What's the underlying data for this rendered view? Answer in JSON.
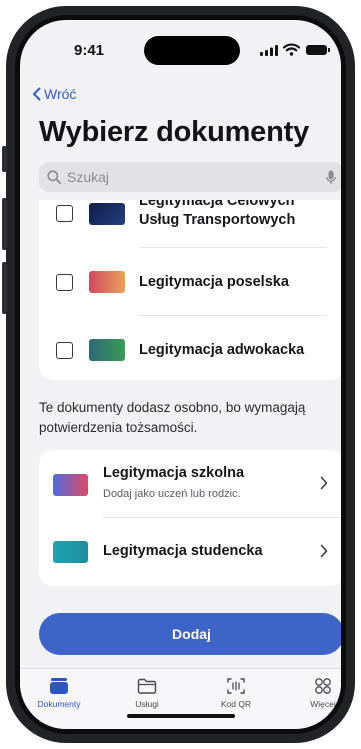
{
  "status_bar": {
    "time": "9:41"
  },
  "nav": {
    "back_label": "Wróć"
  },
  "header": {
    "title": "Wybierz dokumenty"
  },
  "search": {
    "placeholder": "Szukaj"
  },
  "documents": [
    {
      "label_line1": "Legitymacja Celowych",
      "label_line2": "Usług Transportowych",
      "checked": false,
      "card_color": "#20306a"
    },
    {
      "label": "Legitymacja poselska",
      "checked": false,
      "card_color": "#d9545e"
    },
    {
      "label": "Legitymacja adwokacka",
      "checked": false,
      "card_color": "#2f8c5e"
    }
  ],
  "note": {
    "text": "Te dokumenty dodasz osobno, bo wymagają potwierdzenia tożsamości."
  },
  "separate_documents": [
    {
      "label": "Legitymacja szkolna",
      "sublabel": "Dodaj jako uczeń lub rodzic.",
      "card_color": "#4466dd"
    },
    {
      "label": "Legitymacja studencka",
      "card_color": "#23a3ae"
    }
  ],
  "primary_action": {
    "label": "Dodaj",
    "color": "#3d64c8"
  },
  "tab_bar": {
    "tabs": [
      {
        "label": "Dokumenty",
        "icon": "wallet-icon",
        "active": true
      },
      {
        "label": "Usługi",
        "icon": "folder-icon",
        "active": false
      },
      {
        "label": "Kod QR",
        "icon": "qr-scan-icon",
        "active": false
      },
      {
        "label": "Więcej",
        "icon": "grid-more-icon",
        "active": false
      }
    ],
    "active_color": "#2c55c4"
  }
}
